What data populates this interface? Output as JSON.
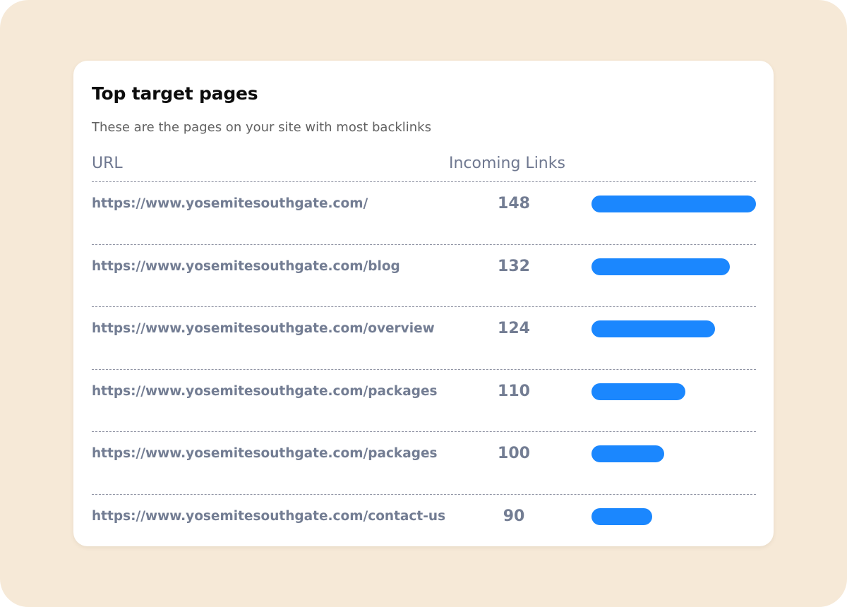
{
  "card": {
    "title": "Top target pages",
    "subtitle": "These are the pages on your site with most backlinks"
  },
  "table": {
    "headers": {
      "url": "URL",
      "links": "Incoming Links"
    },
    "bar_color": "#1b87fe",
    "rows": [
      {
        "url": "https://www.yosemitesouthgate.com/",
        "count": "148",
        "level": 1.0
      },
      {
        "url": "https://www.yosemitesouthgate.com/blog",
        "count": "132",
        "level": 0.84
      },
      {
        "url": "https://www.yosemitesouthgate.com/overview",
        "count": "124",
        "level": 0.75
      },
      {
        "url": "https://www.yosemitesouthgate.com/packages",
        "count": "110",
        "level": 0.57
      },
      {
        "url": "https://www.yosemitesouthgate.com/packages",
        "count": "100",
        "level": 0.44
      },
      {
        "url": "https://www.yosemitesouthgate.com/contact-us",
        "count": "90",
        "level": 0.37
      }
    ]
  }
}
